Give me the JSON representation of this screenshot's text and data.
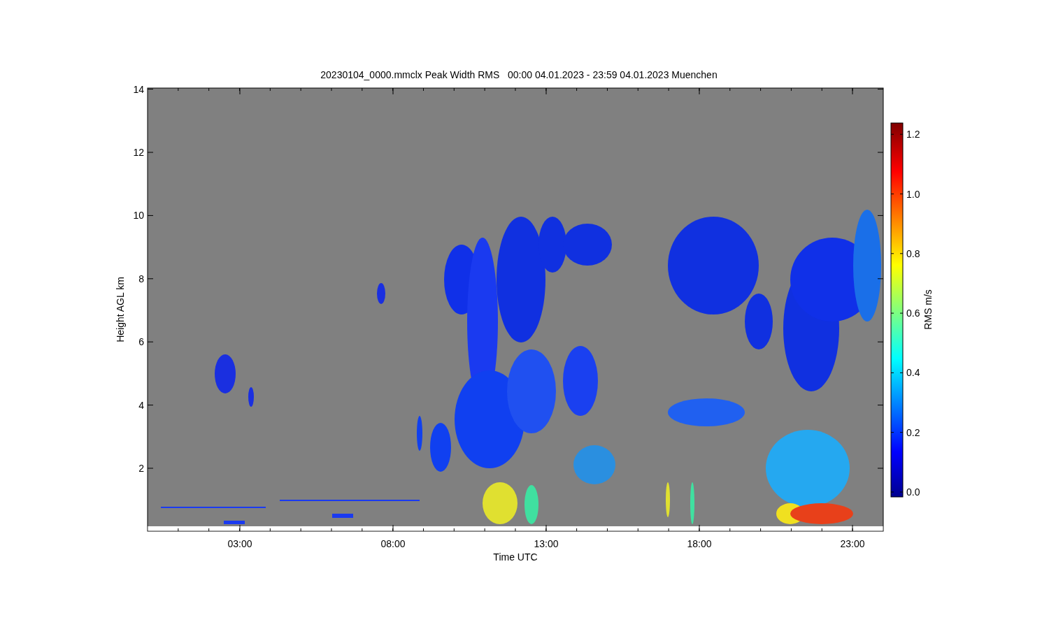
{
  "title": "20230104_0000.mmclx Peak Width RMS   00:00 04.01.2023 - 23:59 04.01.2023 Muenchen",
  "y_axis": {
    "label": "Height AGL km",
    "ticks": [
      "14",
      "12",
      "10",
      "8",
      "6",
      "4",
      "2"
    ]
  },
  "x_axis": {
    "label": "Time UTC",
    "ticks": [
      "03:00",
      "08:00",
      "13:00",
      "18:00",
      "23:00"
    ]
  },
  "colorbar": {
    "label": "RMS m/s",
    "ticks": [
      "1.2",
      "1.0",
      "0.8",
      "0.6",
      "0.4",
      "0.2",
      "0.0"
    ]
  }
}
